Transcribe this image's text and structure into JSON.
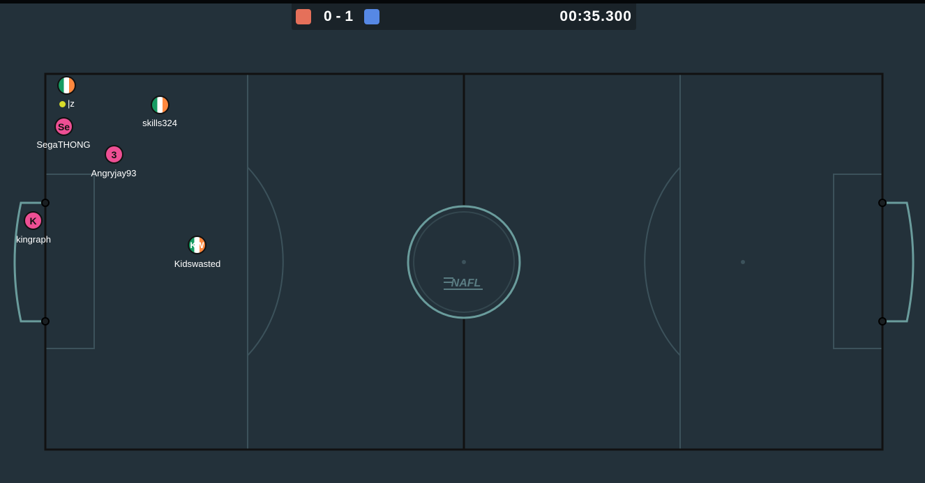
{
  "scoreboard": {
    "score": "0 - 1",
    "timer": "00:35.300",
    "red_color": "#e5705a",
    "blue_color": "#5688e5"
  },
  "field": {
    "logo_text": "NAFL",
    "line_color": "#111111",
    "marking_color": "#3c525b",
    "goal_color": "#6a9c9c"
  },
  "players": [
    {
      "name": "|z",
      "avatar": "",
      "style": "flag"
    },
    {
      "name": "skills324",
      "avatar": "",
      "style": "flag"
    },
    {
      "name": "SegaTHONG",
      "avatar": "Se",
      "style": "pink"
    },
    {
      "name": "Angryjay93",
      "avatar": "3",
      "style": "pink"
    },
    {
      "name": "kingraph",
      "avatar": "K",
      "style": "pink"
    },
    {
      "name": "Kidswasted",
      "avatar": "KW",
      "style": "flag"
    }
  ]
}
